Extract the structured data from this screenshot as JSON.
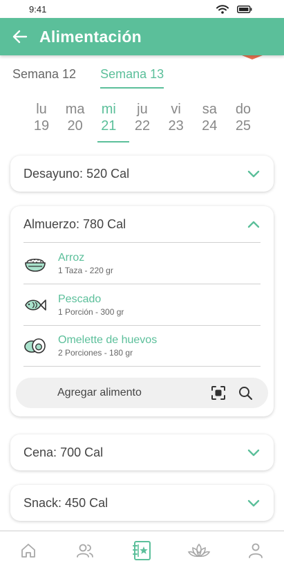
{
  "status": {
    "time": "9:41"
  },
  "header": {
    "title": "Alimentación"
  },
  "weeks": [
    {
      "label": "Semana 12",
      "active": false
    },
    {
      "label": "Semana 13",
      "active": true
    }
  ],
  "days": [
    {
      "abbr": "lu",
      "num": "19",
      "active": false
    },
    {
      "abbr": "ma",
      "num": "20",
      "active": false
    },
    {
      "abbr": "mi",
      "num": "21",
      "active": true
    },
    {
      "abbr": "ju",
      "num": "22",
      "active": false
    },
    {
      "abbr": "vi",
      "num": "23",
      "active": false
    },
    {
      "abbr": "sa",
      "num": "24",
      "active": false
    },
    {
      "abbr": "do",
      "num": "25",
      "active": false
    }
  ],
  "meals": {
    "breakfast": {
      "title": "Desayuno:",
      "calories": "520 Cal",
      "expanded": false
    },
    "lunch": {
      "title": "Almuerzo:",
      "calories": "780 Cal",
      "expanded": true,
      "foods": [
        {
          "name": "Arroz",
          "quantity": "1 Taza - 220 gr",
          "icon": "rice-bowl-icon"
        },
        {
          "name": "Pescado",
          "quantity": "1 Porción - 300 gr",
          "icon": "fish-icon"
        },
        {
          "name": "Omelette de huevos",
          "quantity": "2 Porciones - 180 gr",
          "icon": "egg-icon"
        }
      ],
      "add_label": "Agregar alimento"
    },
    "dinner": {
      "title": "Cena:",
      "calories": "700 Cal",
      "expanded": false
    },
    "snack": {
      "title": "Snack:",
      "calories": "450 Cal",
      "expanded": false
    }
  },
  "nav": [
    {
      "icon": "home-icon",
      "active": false
    },
    {
      "icon": "community-icon",
      "active": false
    },
    {
      "icon": "nutrition-journal-icon",
      "active": true
    },
    {
      "icon": "lotus-icon",
      "active": false
    },
    {
      "icon": "profile-icon",
      "active": false
    }
  ],
  "colors": {
    "accent": "#5bbf9a",
    "nav_inactive": "#a8a8a8",
    "highlight": "#e8704f"
  }
}
